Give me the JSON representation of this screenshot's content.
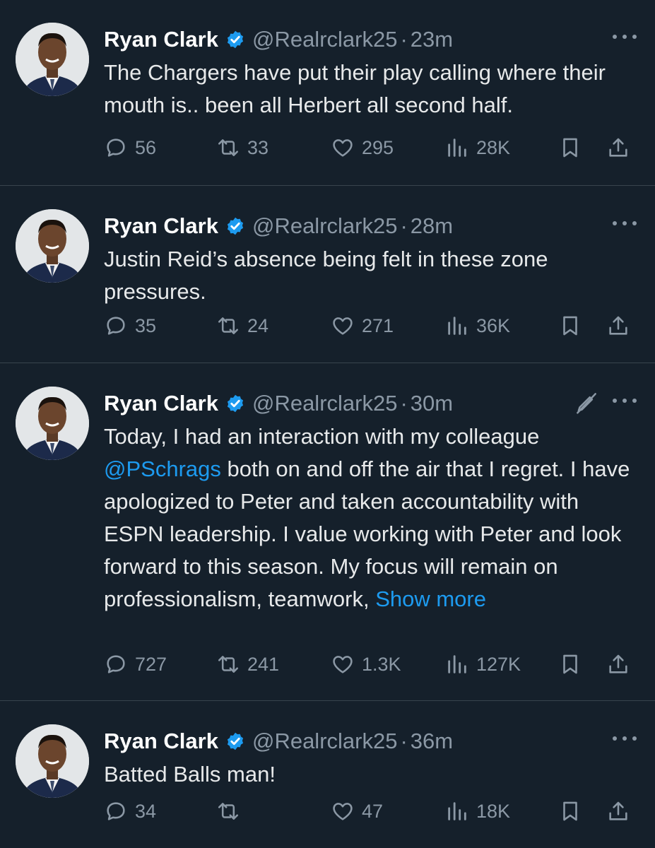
{
  "tweets": [
    {
      "name": "Ryan Clark",
      "handle": "@Realrclark25",
      "separator": "·",
      "time": "23m",
      "body": [
        "The Chargers have put their play calling where their mouth is.. been all Herbert all second half."
      ],
      "replies": "56",
      "retweets": "33",
      "likes": "295",
      "views": "28K"
    },
    {
      "name": "Ryan Clark",
      "handle": "@Realrclark25",
      "separator": "·",
      "time": "28m",
      "body": [
        "Justin Reid’s absence being felt in these zone pressures."
      ],
      "replies": "35",
      "retweets": "24",
      "likes": "271",
      "views": "36K"
    },
    {
      "name": "Ryan Clark",
      "handle": "@Realrclark25",
      "separator": "·",
      "time": "30m",
      "body_pre": "Today, I had an interaction with my colleague",
      "mention": "@PSchrags",
      "body_post": " both on and off the air that I regret. I have apologized to Peter and taken accountability with ESPN leadership. I value working with Peter and look forward to this season. My focus will remain on professionalism, teamwork, ",
      "show_more": "Show more",
      "replies": "727",
      "retweets": "241",
      "likes": "1.3K",
      "views": "127K"
    },
    {
      "name": "Ryan Clark",
      "handle": "@Realrclark25",
      "separator": "·",
      "time": "36m",
      "body": [
        "Batted Balls man!"
      ],
      "replies": "34",
      "retweets": "",
      "likes": "47",
      "views": "18K"
    }
  ],
  "icons": {
    "reply": "speech-bubble-icon",
    "retweet": "retweet-arrows-icon",
    "like": "heart-icon",
    "views": "bar-chart-icon",
    "bookmark": "bookmark-icon",
    "share": "share-upload-icon",
    "verified": "verified-badge-icon",
    "more": "more-dots-icon",
    "not_editable": "edit-disabled-icon"
  },
  "colors": {
    "background": "#15202b",
    "text": "#e7e9ea",
    "secondary": "#8b98a5",
    "link": "#1d9bf0",
    "verified": "#1d9bf0",
    "divider": "#38444d"
  }
}
